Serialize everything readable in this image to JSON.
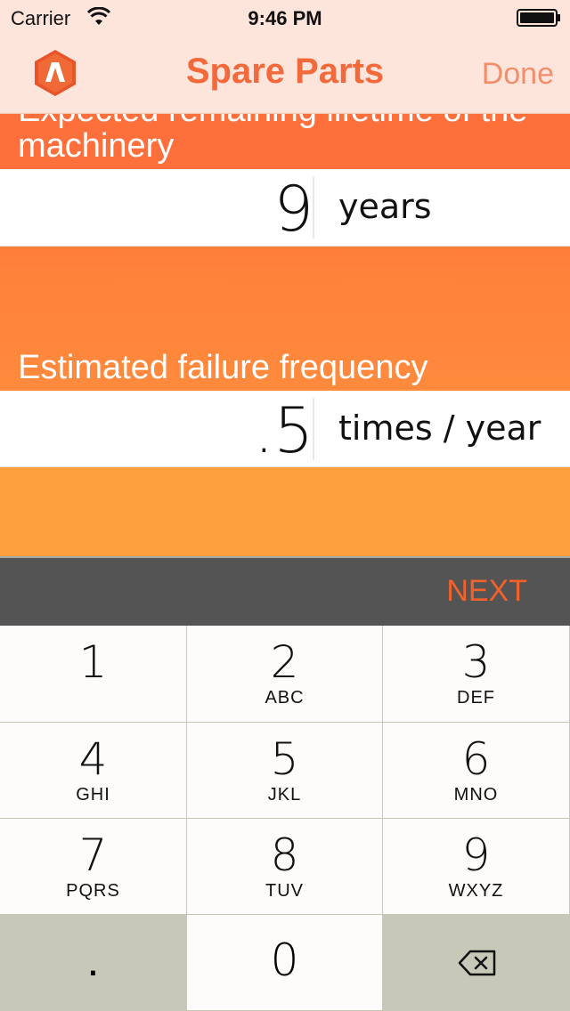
{
  "status": {
    "carrier": "Carrier",
    "time": "9:46 PM"
  },
  "nav": {
    "title": "Spare Parts",
    "done": "Done",
    "logo_icon": "app-logo-a"
  },
  "fields": [
    {
      "label": "Expected remaining lifetime of the machinery",
      "value": "9",
      "unit": "years"
    },
    {
      "label": "Estimated failure frequency",
      "value": ".5",
      "unit": "times / year"
    }
  ],
  "next_label": "NEXT",
  "keypad": {
    "k1": {
      "num": "1",
      "letters": ""
    },
    "k2": {
      "num": "2",
      "letters": "ABC"
    },
    "k3": {
      "num": "3",
      "letters": "DEF"
    },
    "k4": {
      "num": "4",
      "letters": "GHI"
    },
    "k5": {
      "num": "5",
      "letters": "JKL"
    },
    "k6": {
      "num": "6",
      "letters": "MNO"
    },
    "k7": {
      "num": "7",
      "letters": "PQRS"
    },
    "k8": {
      "num": "8",
      "letters": "TUV"
    },
    "k9": {
      "num": "9",
      "letters": "WXYZ"
    },
    "dot": ".",
    "k0": "0"
  },
  "colors": {
    "header_bg": "#fde5dc",
    "accent": "#f26a3c",
    "band1": "#fd6f3b",
    "band2": "#ff8a3c",
    "band3": "#ff9f3e",
    "next_bar": "#545454"
  }
}
